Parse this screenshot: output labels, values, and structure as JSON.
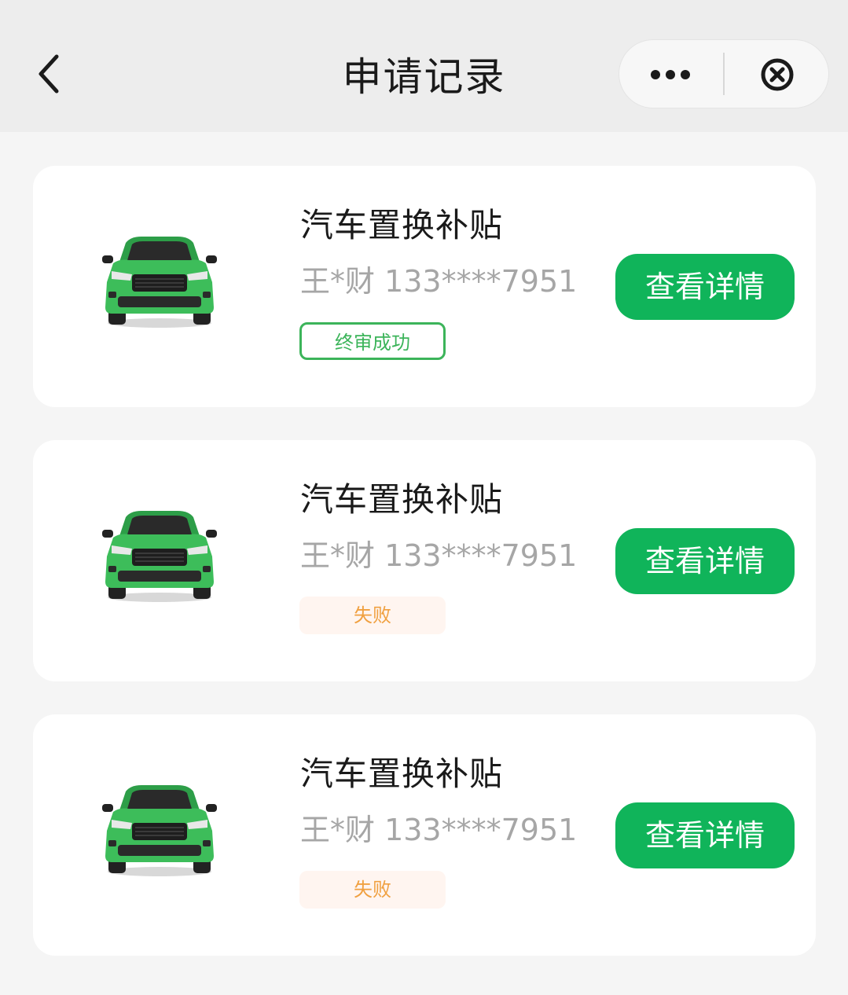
{
  "header": {
    "title": "申请记录"
  },
  "records": [
    {
      "title": "汽车置换补贴",
      "applicant": "王*财 133****7951",
      "status": "终审成功",
      "status_type": "success",
      "button_label": "查看详情"
    },
    {
      "title": "汽车置换补贴",
      "applicant": "王*财 133****7951",
      "status": "失败",
      "status_type": "fail",
      "button_label": "查看详情"
    },
    {
      "title": "汽车置换补贴",
      "applicant": "王*财 133****7951",
      "status": "失败",
      "status_type": "fail",
      "button_label": "查看详情"
    }
  ],
  "colors": {
    "accent": "#10b45a",
    "success": "#3cb45a",
    "fail": "#f0a040",
    "fail_bg": "#fff5f0",
    "car_body": "#3dbd5a"
  },
  "icons": {
    "back": "chevron-left-icon",
    "more": "more-dots-icon",
    "close": "close-circle-icon",
    "car": "car-icon"
  }
}
